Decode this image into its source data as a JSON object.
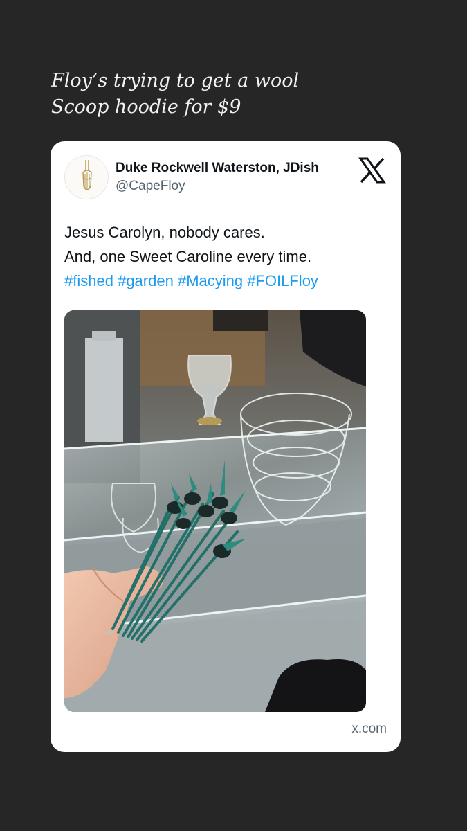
{
  "story": {
    "caption_lines": [
      "Floy’s trying to get a wool",
      "Scoop hoodie for $9"
    ]
  },
  "post": {
    "author_name": "Duke Rockwell Waterston, JDish",
    "author_handle": "@CapeFloy",
    "text_lines": [
      "Jesus Carolyn, nobody cares.",
      "And, one Sweet Caroline every time."
    ],
    "hashtags": [
      "#fished",
      "#garden",
      "#Macying",
      "#FOILFloy"
    ],
    "source_domain": "x.com",
    "platform_icon": "x-logo-icon"
  },
  "colors": {
    "background": "#262626",
    "card": "#ffffff",
    "hashtag": "#1d9bf0",
    "secondary_text": "#536471"
  }
}
